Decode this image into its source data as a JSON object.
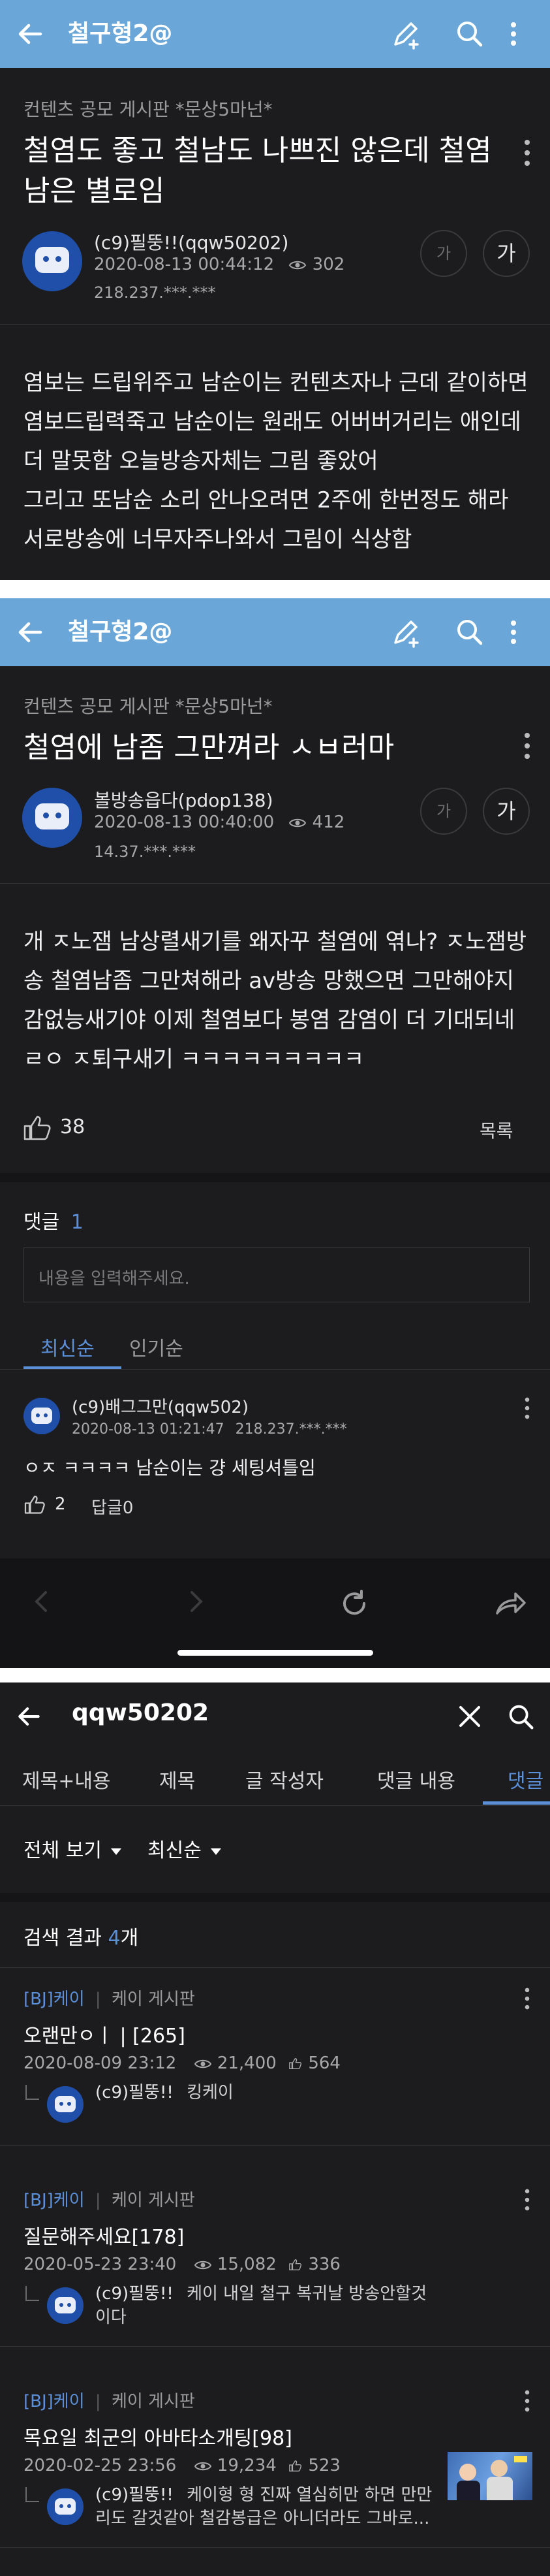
{
  "colors": {
    "accent": "#6aa7d8",
    "panel_bg": "#1c1c1e",
    "link_blue": "#5b8fd8",
    "text_white": "#ffffff"
  },
  "post1": {
    "appbar": {
      "title": "철구형2@"
    },
    "board": "컨텐츠 공모 게시판 *문상5마넌*",
    "title": "철염도 좋고 철남도 나쁘진 않은데 철염남은 별로임",
    "author": "(c9)필뚱!!(qqw50202)",
    "datetime": "2020-08-13 00:44:12",
    "views": "302",
    "ip": "218.237.***.***",
    "font_small": "가",
    "font_large": "가",
    "body": "염보는 드립위주고 남순이는 컨텐츠자나 근데 같이하면 염보드립력죽고 남순이는 원래도 어버버거리는 애인데 더 말못함 오늘방송자체는 그림 좋았어\n그리고 또남순 소리 안나오려면 2주에 한번정도 해라 서로방송에 너무자주나와서 그림이 식상함"
  },
  "post2": {
    "appbar": {
      "title": "철구형2@"
    },
    "board": "컨텐츠 공모 게시판 *문상5마넌*",
    "title": "철염에 남좀 그만껴라 ㅅㅂ러마",
    "author": "볼방송읍다(pdop138)",
    "datetime": "2020-08-13 00:40:00",
    "views": "412",
    "ip": "14.37.***.***",
    "font_small": "가",
    "font_large": "가",
    "body": "개 ㅈ노잼 남상렬새기를 왜자꾸 철염에 엮나? ㅈ노잼방송 철염남좀 그만쳐해라 av방송 망했으면 그만해야지 감없능새기야 이제 철염보다 봉염 감염이 더 기대되네 ㄹㅇ ㅈ퇴구새기 ㅋㅋㅋㅋㅋㅋㅋㅋㅋ",
    "likes": "38",
    "list_label": "목록",
    "comments_label": "댓글",
    "comments_count": "1",
    "comment_placeholder": "내용을 입력해주세요.",
    "sort_tabs": [
      "최신순",
      "인기순"
    ],
    "comment": {
      "author": "(c9)배그그만(qqw502)",
      "datetime": "2020-08-13 01:21:47",
      "ip": "218.237.***.***",
      "text": "ㅇㅈ ㅋㅋㅋㅋ 남순이는 걍 세팅셔틀임",
      "likes": "2",
      "reply": "답글0"
    }
  },
  "search": {
    "query": "qqw50202",
    "tabs": [
      "제목+내용",
      "제목",
      "글 작성자",
      "댓글 내용",
      "댓글"
    ],
    "filter_all": "전체 보기",
    "filter_sort": "최신순",
    "result_prefix": "검색 결과 ",
    "result_count": "4",
    "result_suffix": "개",
    "results": [
      {
        "tag": "[BJ]케이",
        "board": "케이 게시판",
        "title": "오랜만ㅇㅣ | [265]",
        "date": "2020-08-09 23:12",
        "views": "21,400",
        "likes": "564",
        "commenter": "(c9)필뚱!!",
        "comment": "킹케이"
      },
      {
        "tag": "[BJ]케이",
        "board": "케이 게시판",
        "title": "질문해주세요[178]",
        "date": "2020-05-23 23:40",
        "views": "15,082",
        "likes": "336",
        "commenter": "(c9)필뚱!!",
        "comment": "케이 내일 철구 복귀날 방송안할것이다"
      },
      {
        "tag": "[BJ]케이",
        "board": "케이 게시판",
        "title": "목요일 최군의 아바타소개팅[98]",
        "date": "2020-02-25 23:56",
        "views": "19,234",
        "likes": "523",
        "commenter": "(c9)필뚱!!",
        "comment": "케이형 형 진짜 열심히만 하면 만만리도 갈것같아 철감봉급은 아니더라도 그바로..."
      }
    ]
  }
}
